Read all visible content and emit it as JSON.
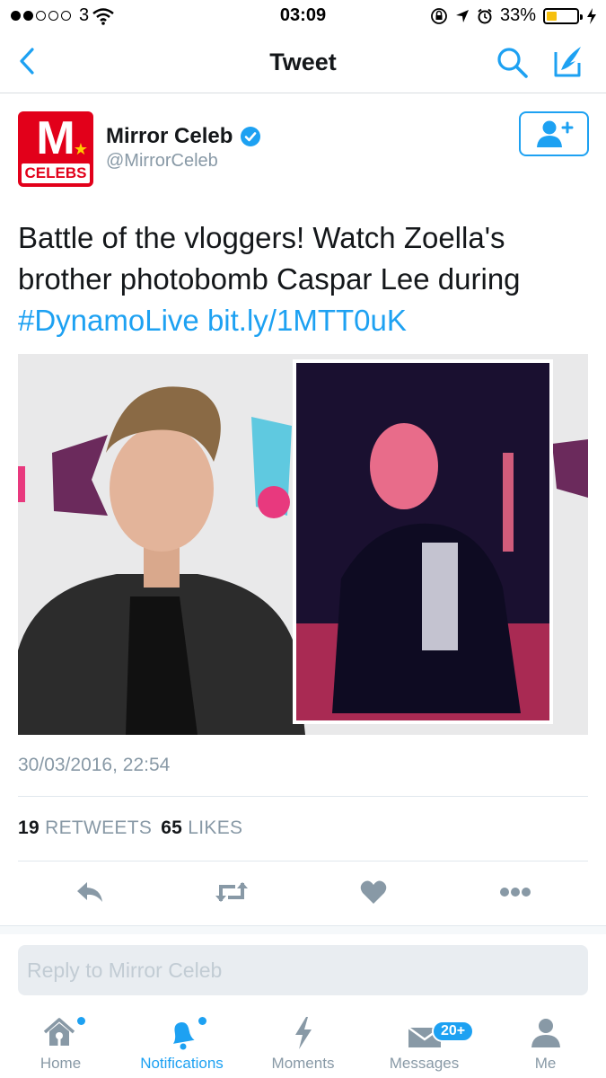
{
  "status_bar": {
    "carrier": "3",
    "time": "03:09",
    "battery_percent": "33%",
    "battery_level": 0.33,
    "signal_bars_filled": 2,
    "signal_bars_total": 5
  },
  "nav": {
    "title": "Tweet",
    "back_icon": "chevron-left-icon",
    "search_icon": "search-icon",
    "compose_icon": "compose-tweet-icon"
  },
  "author": {
    "name": "Mirror Celeb",
    "handle": "@MirrorCeleb",
    "avatar_letter": "M",
    "avatar_band": "CELEBS",
    "verified": true
  },
  "tweet": {
    "text": "Battle of the vloggers! Watch Zoella's brother photobomb Caspar Lee during ",
    "hashtag": "#DynamoLive",
    "link": "bit.ly/1MTT0uK",
    "timestamp": "30/03/2016, 22:54"
  },
  "stats": {
    "retweets_count": "19",
    "retweets_label": "RETWEETS",
    "likes_count": "65",
    "likes_label": "LIKES"
  },
  "reply": {
    "placeholder": "Reply to Mirror Celeb"
  },
  "tabs": [
    {
      "label": "Home",
      "icon": "home-icon"
    },
    {
      "label": "Notifications",
      "icon": "bell-icon"
    },
    {
      "label": "Moments",
      "icon": "lightning-icon"
    },
    {
      "label": "Messages",
      "icon": "envelope-icon",
      "badge": "20+"
    },
    {
      "label": "Me",
      "icon": "person-icon"
    }
  ],
  "colors": {
    "accent": "#1da1f2",
    "secondary_text": "#8899a6",
    "brand_red": "#e2001a"
  }
}
